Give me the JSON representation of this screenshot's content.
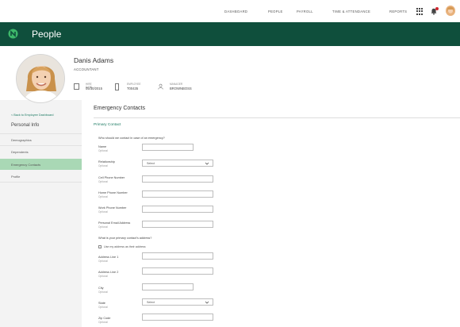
{
  "topnav": {
    "items": [
      "DASHBOARD",
      "PEOPLE",
      "PAYROLL",
      "TIME & ATTENDANCE",
      "REPORTS"
    ],
    "icons": [
      "apps-grid-icon",
      "notification-bell-icon",
      "user-avatar-icon"
    ],
    "badge_color": "#d0262e"
  },
  "header": {
    "title": "People",
    "background": "#0f4f3c",
    "icon": "logo-icon"
  },
  "profile": {
    "name": "Danis Adams",
    "job_title": "ACCOUNTANT",
    "meta": [
      {
        "label": "HIRE DATE",
        "value": "05/30/2015",
        "icon": "calendar-icon"
      },
      {
        "label": "EMPLOYEE",
        "value": "T00435",
        "icon": "building-icon"
      },
      {
        "label": "MANAGER",
        "value": "BROWNBOSS",
        "icon": "person-icon"
      }
    ]
  },
  "sidebar": {
    "back_link": "< Back to Employee Dashboard",
    "section": "Personal Info",
    "items": [
      "Demographics",
      "Dependents",
      "Emergency Contacts",
      "Profile"
    ],
    "active_color": "#a9d8b5"
  },
  "main": {
    "title": "Emergency Contacts",
    "subtitle": "Primary Contact",
    "question1": "Who should we contact in case of an emergency?",
    "fields1": [
      {
        "label": "Name",
        "opt": "Optional"
      },
      {
        "label": "Relationship",
        "opt": "Optional",
        "select": "Select"
      },
      {
        "label": "Cell Phone Number",
        "opt": "Optional"
      },
      {
        "label": "Home Phone Number",
        "opt": "Optional"
      },
      {
        "label": "Work Phone Number",
        "opt": "Optional"
      },
      {
        "label": "Personal Email Address",
        "opt": "Optional"
      }
    ],
    "question2": "What is your primary contact's address?",
    "checkbox_label": "Use my address as their address",
    "fields2": [
      {
        "label": "Address Line 1",
        "opt": "Optional"
      },
      {
        "label": "Address Line 2",
        "opt": "Optional"
      },
      {
        "label": "City",
        "opt": "Optional"
      },
      {
        "label": "State",
        "opt": "Optional",
        "select": "Select"
      },
      {
        "label": "Zip Code",
        "opt": "Optional"
      }
    ],
    "accent_color": "#1c7a62"
  }
}
